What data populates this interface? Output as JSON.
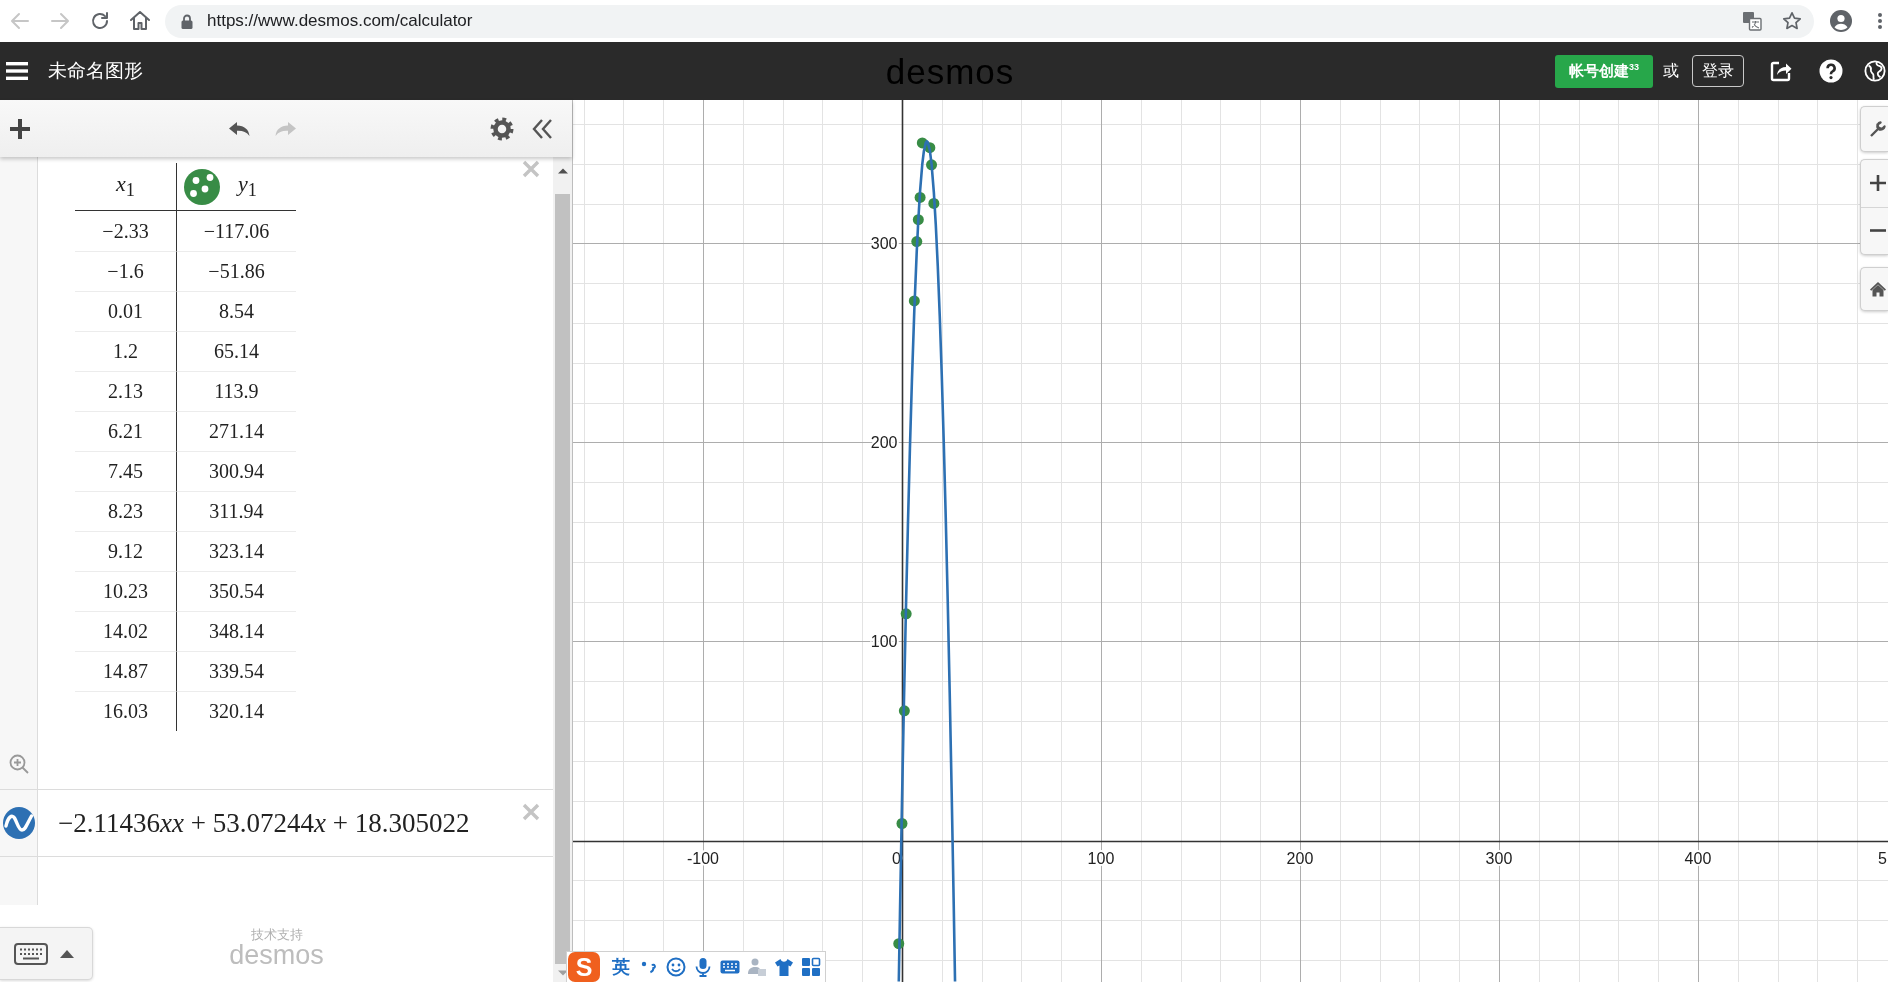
{
  "browser": {
    "nav": [
      {
        "kind": "back",
        "disabled": true
      },
      {
        "kind": "forward",
        "disabled": true
      },
      {
        "kind": "reload",
        "disabled": false
      },
      {
        "kind": "home",
        "disabled": false
      }
    ],
    "url": "https://www.desmos.com/calculator"
  },
  "header": {
    "title": "未命名图形",
    "logo": "desmos",
    "signup": "帐号创建$^{33}$",
    "or": "或",
    "login": "登录"
  },
  "toolbar": {
    "history": [
      {
        "kind": "undo",
        "disabled": false
      },
      {
        "kind": "redo",
        "disabled": true
      }
    ]
  },
  "expressions": [
    {
      "kind": "table",
      "color": "#388c46",
      "columns": [
        "*x*$_{1}$",
        "*y*$_{1}$"
      ],
      "rows": [
        [
          "−2.33",
          "−117.06"
        ],
        [
          "−1.6",
          "−51.86"
        ],
        [
          "0.01",
          "8.54"
        ],
        [
          "1.2",
          "65.14"
        ],
        [
          "2.13",
          "113.9"
        ],
        [
          "6.21",
          "271.14"
        ],
        [
          "7.45",
          "300.94"
        ],
        [
          "8.23",
          "311.94"
        ],
        [
          "9.12",
          "323.14"
        ],
        [
          "10.23",
          "350.54"
        ],
        [
          "14.02",
          "348.14"
        ],
        [
          "14.87",
          "339.54"
        ],
        [
          "16.03",
          "320.14"
        ]
      ]
    },
    {
      "kind": "formula",
      "color": "#2d70b3",
      "formula": "−2.11436xx + 53.07244x + 18.305022"
    }
  ],
  "branding": {
    "caption": "技术支持",
    "logo": "desmos"
  },
  "graph": {
    "chart_data": {
      "type": "scatter",
      "grid": true,
      "x": [
        -1.6,
        -1.58,
        -1,
        0.01,
        1,
        1.2,
        2,
        2.13,
        3,
        4,
        5,
        6.21,
        7.45,
        8.23,
        9.12,
        10.23,
        11,
        12,
        12.5,
        13,
        14.02,
        14.87,
        16.03,
        17,
        18,
        19,
        20,
        21,
        22,
        23,
        24,
        25,
        26,
        26.68
      ],
      "series": [
        {
          "color": "#388c46",
          "values": [
            -51.86,
            null,
            null,
            8.54,
            null,
            65.14,
            null,
            113.9,
            null,
            null,
            null,
            271.14,
            300.94,
            311.94,
            323.14,
            350.54,
            null,
            null,
            null,
            null,
            348.14,
            339.54,
            320.14,
            null,
            null,
            null,
            null,
            null,
            null,
            null,
            null,
            null,
            null,
            null
          ]
        },
        {
          "type": "line",
          "color": "#2d70b3",
          "values": [
            null,
            -70.8,
            -36.9,
            18.8,
            69.3,
            78.9,
            116,
            121.8,
            158.5,
            196.8,
            230.8,
            266.3,
            296.3,
            311.9,
            326.5,
            340,
            346.3,
            350.7,
            351.3,
            350.9,
            346.8,
            340,
            325.7,
            309.5,
            288.6,
            263.4,
            234,
            200.4,
            162.5,
            120.5,
            74.2,
            23.6,
            -31.1,
            -70.8
          ]
        }
      ],
      "xlim": [
        -165.3,
        495.5
      ],
      "ylim": [
        -71.1,
        372.1
      ],
      "xticks": [
        -100,
        0,
        100,
        200,
        300,
        400
      ],
      "yticks": [
        100,
        200,
        300
      ]
    },
    "cut_tick_label": "5"
  },
  "ime_toolbar": {
    "logo": "S",
    "mode": "英"
  }
}
